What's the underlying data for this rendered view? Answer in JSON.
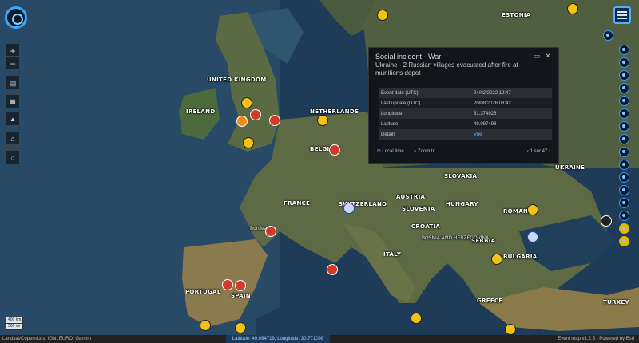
{
  "popup": {
    "category": "Social incident - War",
    "headline": "Ukraine - 2 Russian villages evacuated after fire at munitions depot",
    "rows": [
      {
        "key": "Event date (UTC)",
        "value": "24/02/2022 12:47"
      },
      {
        "key": "Last update (UTC)",
        "value": "20/08/2026 08:42"
      },
      {
        "key": "Longitude",
        "value": "31.374926"
      },
      {
        "key": "Latitude",
        "value": "49.097498"
      },
      {
        "key": "Details",
        "value": "Vue"
      }
    ],
    "local_time": "Local time",
    "zoom_to": "Zoom to",
    "pager": "1 sur 47"
  },
  "map_labels": {
    "countries": {
      "uk": "UNITED KINGDOM",
      "ireland": "IRELAND",
      "netherlands": "NETHERLANDS",
      "belgium": "BELGIUM",
      "france": "FRANCE",
      "spain": "SPAIN",
      "portugal": "PORTUGAL",
      "austria": "AUSTRIA",
      "switzerland": "SWITZERLAND",
      "italy": "ITALY",
      "slovakia": "SLOVAKIA",
      "hungary": "HUNGARY",
      "romania": "ROMANIA",
      "bulgaria": "BULGARIA",
      "serbia": "SERBIA",
      "croatia": "CROATIA",
      "bosnia": "BOSNIA AND HERZEGOVINA",
      "slovenia": "SLOVENIA",
      "greece": "GREECE",
      "turkey": "TURKEY",
      "ukraine": "UKRAINE",
      "estonia": "ESTONIA"
    },
    "cities": {
      "bordeaux": "Bordeaux"
    }
  },
  "attribution": "Landsat/Copernicus, IGN, EURO, Garmin",
  "coordinates": "Latitude: 49.094719, Longitude: 30.771098",
  "version": "Event map v1.2.5 - Powered by Esri",
  "scale": {
    "km": "400 km",
    "mi": "300 mi"
  },
  "colors": {
    "accent": "#3aa8ff",
    "incident_red": "#d23b2c",
    "incident_orange": "#f08a1a",
    "incident_yellow": "#f2c314"
  }
}
